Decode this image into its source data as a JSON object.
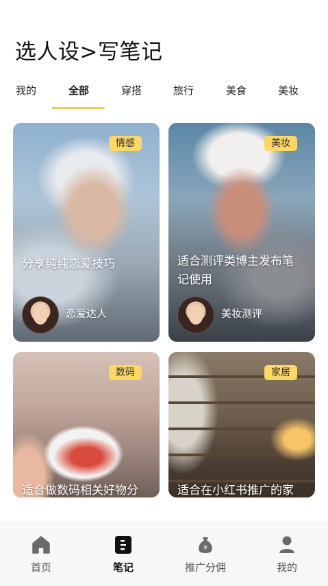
{
  "page": {
    "title": "选人设>写笔记"
  },
  "tabs": [
    {
      "label": "我的"
    },
    {
      "label": "全部"
    },
    {
      "label": "穿搭"
    },
    {
      "label": "旅行"
    },
    {
      "label": "美食"
    },
    {
      "label": "美妆"
    }
  ],
  "active_tab": "全部",
  "cards": [
    {
      "tag": "情感",
      "text": "分享纯纯恋爱技巧",
      "author": "恋爱达人"
    },
    {
      "tag": "美妆",
      "text": "适合测评类博主发布笔记使用",
      "author": "美妆测评"
    },
    {
      "tag": "数码",
      "text": "适合做数码相关好物分"
    },
    {
      "tag": "家居",
      "text": "适合在小红书推广的家"
    }
  ],
  "bottom_nav": [
    {
      "label": "首页",
      "icon": "home-icon"
    },
    {
      "label": "笔记",
      "icon": "note-icon"
    },
    {
      "label": "推广分佣",
      "icon": "money-bag-icon"
    },
    {
      "label": "我的",
      "icon": "user-icon"
    }
  ],
  "colors": {
    "accent": "#f5c94a",
    "tag_bg": "#fbd763",
    "nav_bg": "#f7f7f7"
  }
}
